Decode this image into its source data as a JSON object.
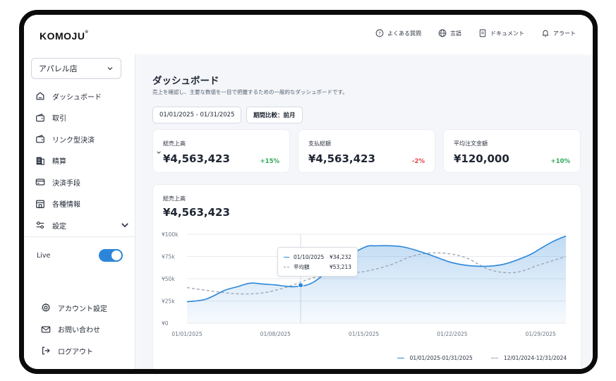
{
  "brand": {
    "logo_text": "KOMOJU",
    "trademark": "®"
  },
  "topnav": [
    {
      "label": "よくある質問",
      "icon": "help-circle-icon"
    },
    {
      "label": "言語",
      "icon": "globe-icon"
    },
    {
      "label": "ドキュメント",
      "icon": "document-icon"
    },
    {
      "label": "アラート",
      "icon": "bell-icon"
    }
  ],
  "sidebar": {
    "store_select": "アパレル店",
    "items": [
      {
        "label": "ダッシュボード",
        "icon": "home-icon"
      },
      {
        "label": "取引",
        "icon": "wallet-icon"
      },
      {
        "label": "リンク型決済",
        "icon": "wallet-link-icon"
      },
      {
        "label": "精算",
        "icon": "receipt-icon"
      },
      {
        "label": "決済手段",
        "icon": "credit-card-icon"
      },
      {
        "label": "各種情報",
        "icon": "store-icon"
      },
      {
        "label": "設定",
        "icon": "settings-sliders-icon"
      }
    ],
    "live_label": "Live",
    "live_enabled": true,
    "bottom_items": [
      {
        "label": "アカウント設定",
        "icon": "gear-icon"
      },
      {
        "label": "お問い合わせ",
        "icon": "mail-icon"
      },
      {
        "label": "ログアウト",
        "icon": "logout-icon"
      }
    ]
  },
  "main": {
    "title": "ダッシュボード",
    "description": "売上を確認し、主要な数値を一目で把握するための一般的なダッシュボードです。",
    "date_range": "01/01/2025 - 01/31/2025",
    "compare": "期間比較：前月",
    "stats": [
      {
        "label": "総売上高",
        "value": "¥4,563,423",
        "delta": "+15%",
        "trend": "positive"
      },
      {
        "label": "支払総額",
        "value": "¥4,563,423",
        "delta": "-2%",
        "trend": "negative"
      },
      {
        "label": "平均注文金額",
        "value": "¥120,000",
        "delta": "+10%",
        "trend": "positive"
      }
    ],
    "chart_card": {
      "label": "総売上高",
      "value": "¥4,563,423"
    },
    "tooltip": {
      "date": "01/10/2025",
      "date_value": "¥34,232",
      "avg_label": "平均額",
      "avg_value": "¥53,213"
    }
  },
  "colors": {
    "accent": "#2b86d9",
    "positive": "#2faa5a",
    "negative": "#e04848",
    "comparison": "#9aa3ae"
  },
  "chart_data": {
    "type": "area",
    "x_ticks": [
      "01/01/2025",
      "01/08/2025",
      "01/15/2025",
      "01/22/2025",
      "01/29/2025"
    ],
    "y_ticks": [
      "¥0",
      "¥25k",
      "¥50k",
      "¥75k",
      "¥100k"
    ],
    "ylim": [
      0,
      100000
    ],
    "grid": true,
    "legend_position": "bottom-right",
    "series": [
      {
        "name": "01/01/2025-01/31/2025",
        "style": "solid-area",
        "x": [
          1,
          2.5,
          4,
          5,
          6,
          7,
          8,
          9.5,
          11,
          13,
          15,
          16,
          18,
          20,
          22,
          24,
          26,
          28,
          29,
          30,
          31
        ],
        "values": [
          24000,
          27000,
          37000,
          41000,
          45000,
          44000,
          43000,
          41000,
          46000,
          68000,
          85000,
          87000,
          86000,
          78000,
          68000,
          64000,
          66000,
          76000,
          84000,
          92000,
          98000
        ]
      },
      {
        "name": "12/01/2024-12/31/2024",
        "style": "dashed",
        "x": [
          1,
          3,
          5,
          7,
          9,
          11,
          13,
          15,
          17,
          19,
          21,
          23,
          25,
          27,
          29,
          31
        ],
        "values": [
          40000,
          36000,
          33000,
          34000,
          41000,
          51000,
          56000,
          58000,
          65000,
          76000,
          79000,
          74000,
          60000,
          57000,
          66000,
          75000
        ]
      }
    ],
    "highlight": {
      "x": 10,
      "label": "01/10/2025"
    }
  }
}
